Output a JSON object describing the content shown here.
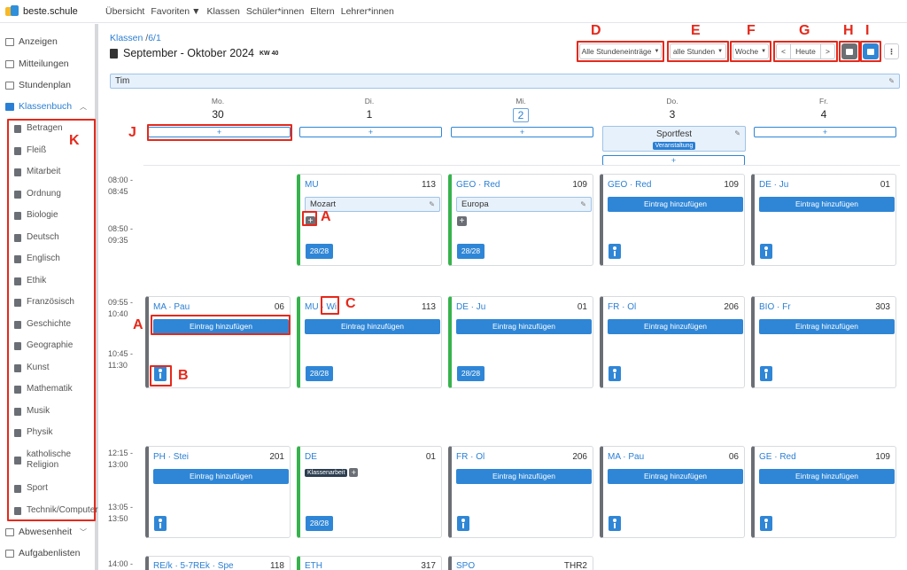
{
  "app": {
    "brand": "beste.schule"
  },
  "topnav": {
    "items": [
      "Übersicht",
      "Favoriten",
      "Klassen",
      "Schüler*innen",
      "Eltern",
      "Lehrer*innen"
    ]
  },
  "sidebar": {
    "top_items": [
      "Anzeigen",
      "Mitteilungen",
      "Stundenplan"
    ],
    "active_item": "Klassenbuch",
    "sub_items": [
      "Betragen",
      "Fleiß",
      "Mitarbeit",
      "Ordnung",
      "Biologie",
      "Deutsch",
      "Englisch",
      "Ethik",
      "Französisch",
      "Geschichte",
      "Geographie",
      "Kunst",
      "Mathematik",
      "Musik",
      "Physik",
      "katholische Religion",
      "Sport",
      "Technik/Computer"
    ],
    "bottom_items": [
      "Abwesenheit",
      "Aufgabenlisten"
    ]
  },
  "breadcrumb": {
    "root": "Klassen",
    "sep": "/",
    "current": "6/1"
  },
  "page": {
    "title": "September - Oktober 2024",
    "week": "KW 40"
  },
  "toolbar": {
    "filter_entries": "Alle Stundeneinträge",
    "filter_lessons": "alle Stunden",
    "view": "Woche",
    "prev": "<",
    "today": "Heute",
    "next": ">",
    "more": "⋮"
  },
  "student_filter": "Tim",
  "days": [
    {
      "name": "Mo.",
      "date": "30"
    },
    {
      "name": "Di.",
      "date": "1"
    },
    {
      "name": "Mi.",
      "date": "2"
    },
    {
      "name": "Do.",
      "date": "3"
    },
    {
      "name": "Fr.",
      "date": "4"
    }
  ],
  "add_label": "+",
  "event": {
    "title": "Sportfest",
    "badge": "Veranstaltung"
  },
  "times": [
    [
      "08:00 -",
      "08:45"
    ],
    [
      "08:50 -",
      "09:35"
    ],
    [
      "09:55 -",
      "10:40"
    ],
    [
      "10:45 -",
      "11:30"
    ],
    [
      "12:15 -",
      "13:00"
    ],
    [
      "13:05 -",
      "13:50"
    ],
    [
      "14:00 -"
    ]
  ],
  "entry_button": "Eintrag hinzufügen",
  "lessons": {
    "row1": [
      {
        "subj": "MU",
        "room": "113",
        "topic": "Mozart",
        "count": "28/28"
      },
      {
        "subj": "GEO · Red",
        "room": "109",
        "topic": "Europa",
        "count": "28/28"
      },
      {
        "subj": "GEO · Red",
        "room": "109"
      },
      {
        "subj": "DE · Ju",
        "room": "01"
      }
    ],
    "row2": [
      {
        "subj": "MA · Pau",
        "room": "06"
      },
      {
        "subj": "MU · Wi",
        "room": "113",
        "count": "28/28"
      },
      {
        "subj": "DE · Ju",
        "room": "01",
        "count": "28/28"
      },
      {
        "subj": "FR · Ol",
        "room": "206"
      },
      {
        "subj": "BIO · Fr",
        "room": "303"
      }
    ],
    "row3": [
      {
        "subj": "PH · Stei",
        "room": "201"
      },
      {
        "subj": "DE",
        "room": "01",
        "badge": "Klassenarbeit",
        "count": "28/28"
      },
      {
        "subj": "FR · Ol",
        "room": "206"
      },
      {
        "subj": "MA · Pau",
        "room": "06"
      },
      {
        "subj": "GE · Red",
        "room": "109"
      }
    ],
    "row4": [
      {
        "subj": "RE/k · 5-7REk · Spe",
        "room": "118"
      },
      {
        "subj": "ETH",
        "room": "317"
      },
      {
        "subj": "SPO",
        "room": "THR2"
      }
    ]
  },
  "callouts": {
    "A": "A",
    "B": "B",
    "C": "C",
    "D": "D",
    "E": "E",
    "F": "F",
    "G": "G",
    "H": "H",
    "I": "I",
    "J": "J",
    "K": "K"
  },
  "colors": {
    "accent": "#2f86d6",
    "highlight": "#e5291b",
    "green": "#37b24d"
  }
}
